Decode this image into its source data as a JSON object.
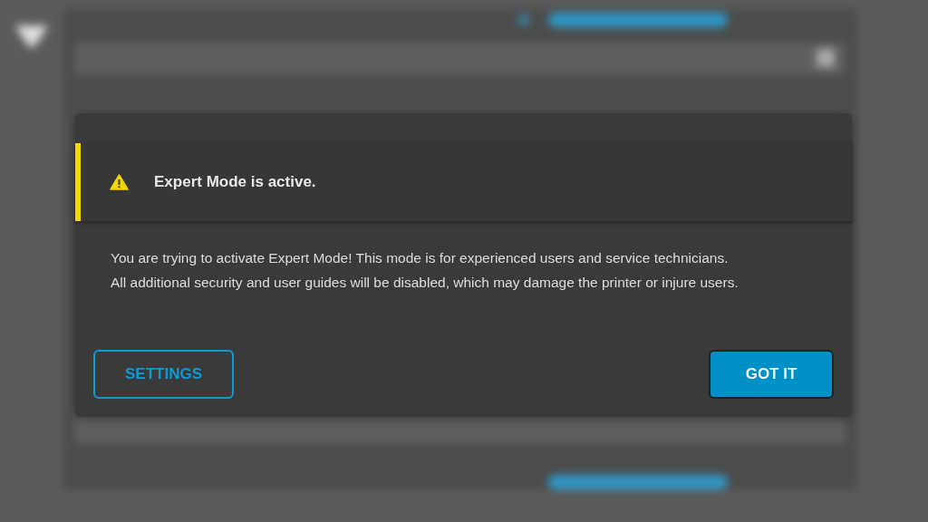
{
  "alert": {
    "title": "Expert Mode is active."
  },
  "message": {
    "lines": [
      "You are trying to activate Expert Mode! This mode is for experienced users and service technicians.",
      "All additional security and user guides will be disabled, which may damage the printer or injure users."
    ]
  },
  "buttons": [
    {
      "kind": "outline",
      "label": "SETTINGS"
    },
    {
      "kind": "primary",
      "label": "GOT IT"
    }
  ]
}
